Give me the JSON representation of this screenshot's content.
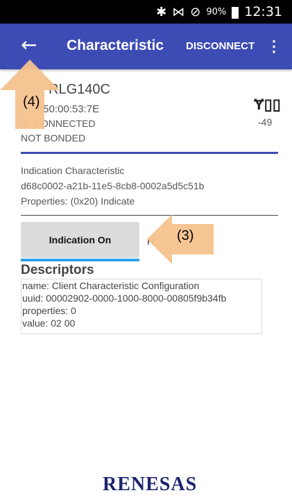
{
  "statusbar": {
    "icons": [
      "bluetooth-icon",
      "vibrate-icon",
      "do-not-disturb-icon",
      "battery-icon"
    ],
    "battery": "90%",
    "time": "12:31"
  },
  "appbar": {
    "back_icon": "arrow-left-icon",
    "title": "Characteristic",
    "disconnect": "DISCONNECT",
    "more_icon": "more-vert-icon",
    "color": "#3d4bb4"
  },
  "device": {
    "name": "RLG140C",
    "mac": ":50:00:53:7E",
    "status": "s:  CONNECTED",
    "bond": "NOT BONDED",
    "signal_icon": "signal-strength-icon",
    "rssi": "-49"
  },
  "characteristic": {
    "name": "Indication Characteristic",
    "uuid": "d68c0002-a21b-11e5-8cb8-0002a5d5c51b",
    "properties": "Properties: (0x20) Indicate"
  },
  "indication": {
    "button": "Indication On",
    "hint": "H",
    "underline_color": "#29a3e6"
  },
  "descriptors": {
    "title": "Descriptors",
    "lines": [
      "name: Client Characteristic Configuration",
      "uuid: 00002902-0000-1000-8000-00805f9b34fb",
      "properties: 0",
      "value: 02 00"
    ]
  },
  "callouts": {
    "back": "(4)",
    "indication": "(3)",
    "color": "#f5c28e"
  },
  "logo": "RENESAS"
}
